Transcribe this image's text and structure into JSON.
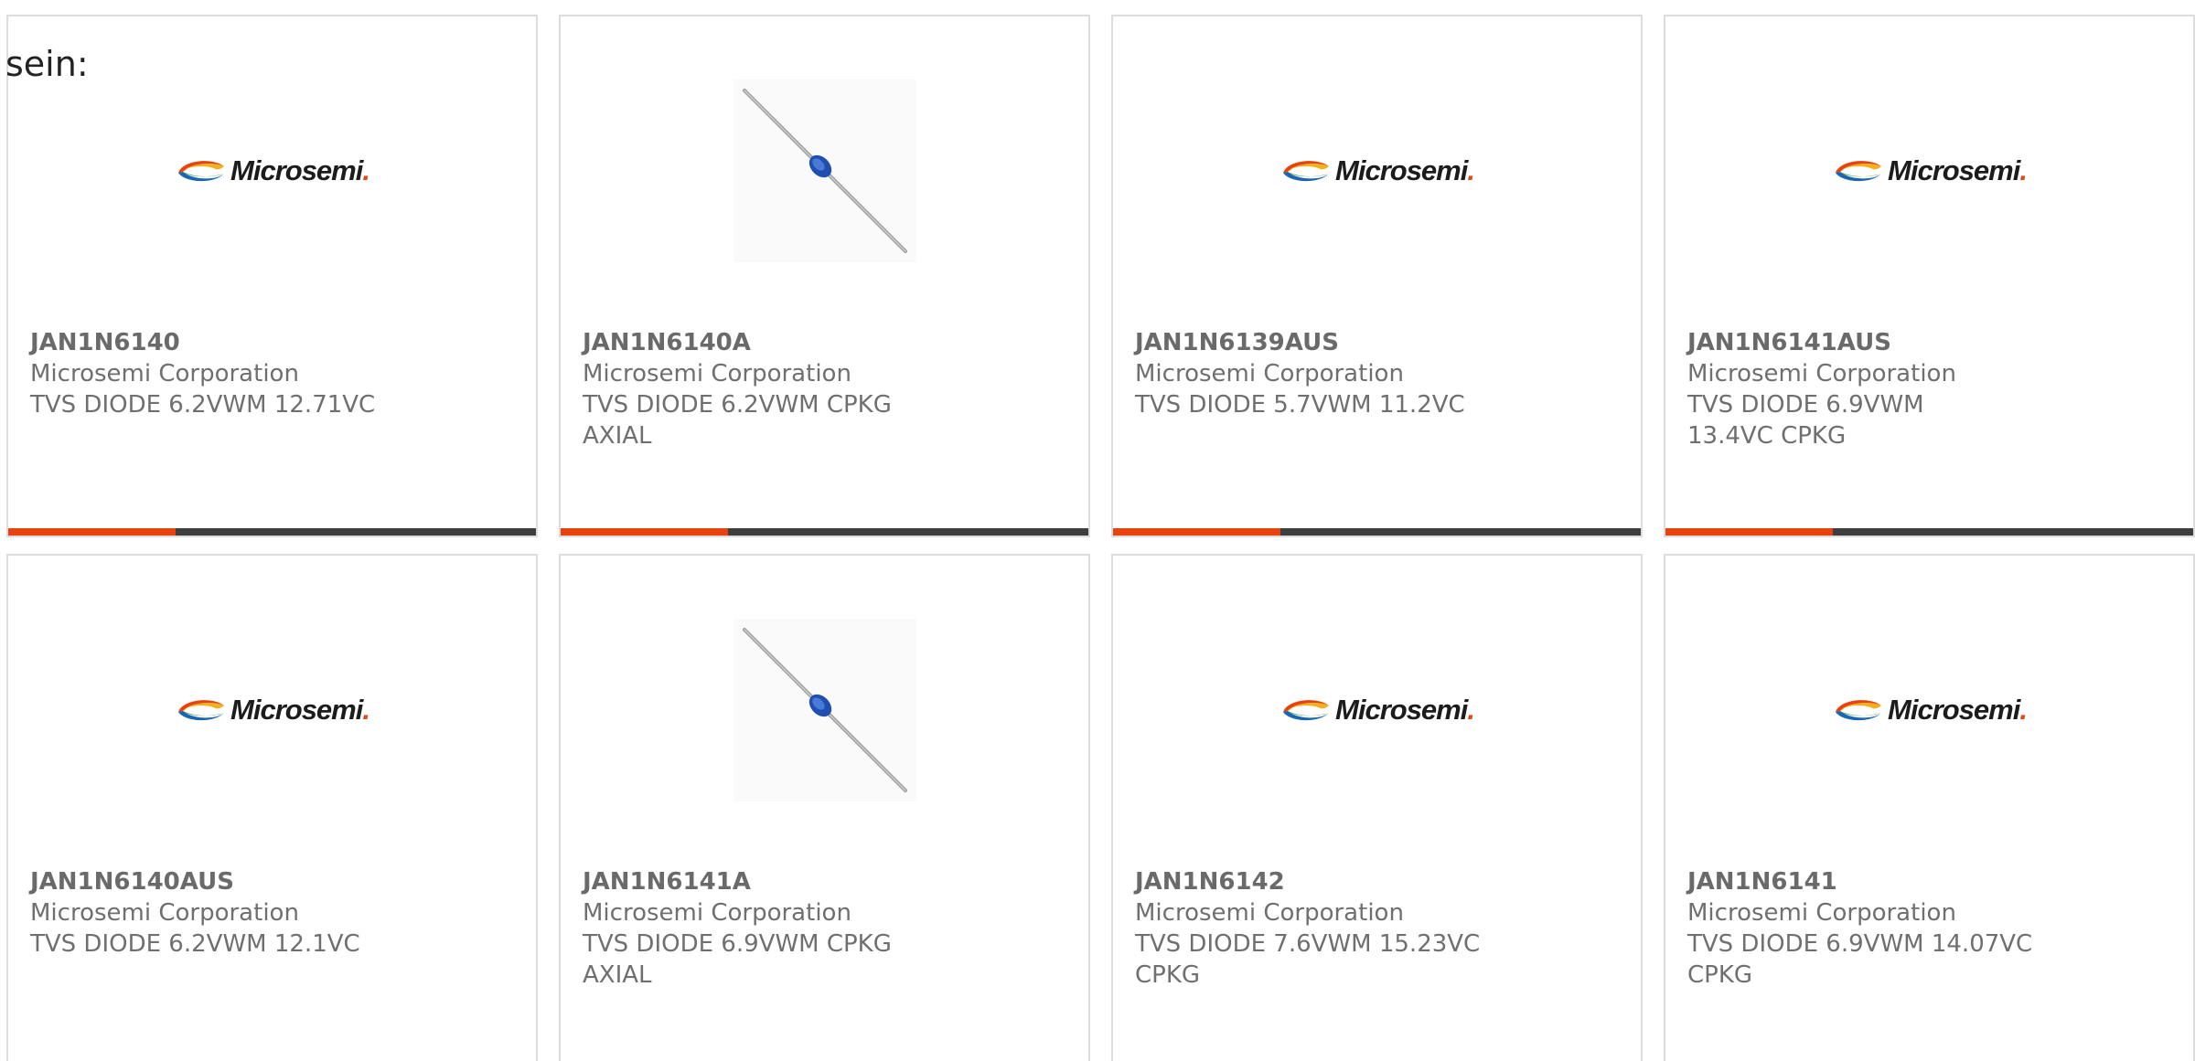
{
  "intro_text": "sein:",
  "brand": {
    "logo_text": "Microsemi",
    "logo_colors": [
      "#e8420f",
      "#f2b11b",
      "#3b9f3e",
      "#1a66b5"
    ]
  },
  "accent_color": "#e8420f",
  "products": [
    {
      "part_number": "JAN1N6140",
      "manufacturer": "Microsemi Corporation",
      "description": "TVS DIODE 6.2VWM 12.71VC",
      "image": "microsemi-logo"
    },
    {
      "part_number": "JAN1N6140A",
      "manufacturer": "Microsemi Corporation",
      "description": "TVS DIODE 6.2VWM CPKG AXIAL",
      "image": "axial-diode"
    },
    {
      "part_number": "JAN1N6139AUS",
      "manufacturer": "Microsemi Corporation",
      "description": "TVS DIODE 5.7VWM 11.2VC",
      "image": "microsemi-logo"
    },
    {
      "part_number": "JAN1N6141AUS",
      "manufacturer": "Microsemi Corporation",
      "description": "TVS DIODE 6.9VWM 13.4VC CPKG",
      "image": "microsemi-logo"
    },
    {
      "part_number": "JAN1N6140AUS",
      "manufacturer": "Microsemi Corporation",
      "description": "TVS DIODE 6.2VWM 12.1VC",
      "image": "microsemi-logo"
    },
    {
      "part_number": "JAN1N6141A",
      "manufacturer": "Microsemi Corporation",
      "description": "TVS DIODE 6.9VWM CPKG AXIAL",
      "image": "axial-diode"
    },
    {
      "part_number": "JAN1N6142",
      "manufacturer": "Microsemi Corporation",
      "description": "TVS DIODE 7.6VWM 15.23VC CPKG",
      "image": "microsemi-logo"
    },
    {
      "part_number": "JAN1N6141",
      "manufacturer": "Microsemi Corporation",
      "description": "TVS DIODE 6.9VWM 14.07VC CPKG",
      "image": "microsemi-logo"
    }
  ]
}
